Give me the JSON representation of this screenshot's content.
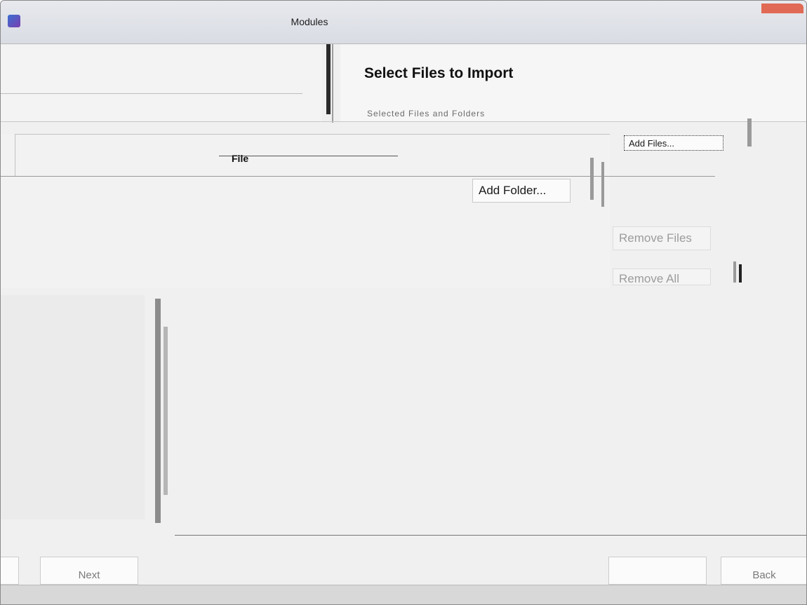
{
  "window": {
    "title": "Modules"
  },
  "wizard": {
    "heading": "Select Files to Import",
    "subheading": "Selected Files and Folders"
  },
  "file_list": {
    "column_file": "File"
  },
  "actions": {
    "add_files_label": "Add Files...",
    "add_folder_label": "Add Folder...",
    "remove_files_label": "Remove Files",
    "remove_all_label": "Remove All"
  },
  "footer": {
    "next_label": "Next",
    "back_label": "Back",
    "status_text": ""
  }
}
